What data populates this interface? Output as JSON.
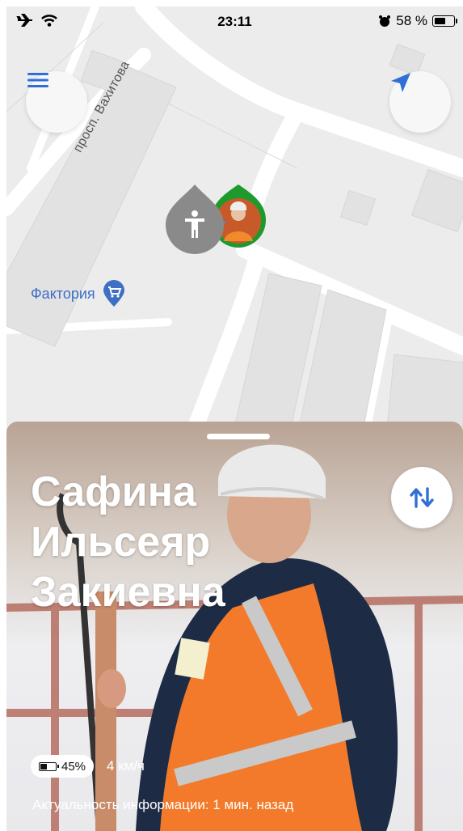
{
  "status_bar": {
    "time": "23:11",
    "battery_percent": "58 %",
    "battery_level": 0.58
  },
  "map": {
    "street_name": "просп. Вахитова",
    "poi_label": "Фактория",
    "icons": {
      "menu": "menu-icon",
      "locate": "location-arrow-icon",
      "poi": "shopping-cart-pin-icon",
      "person": "person-marker-icon"
    },
    "colors": {
      "accent": "#2f6fd6",
      "marker_ring": "#1e9a2c",
      "marker_gray": "#8a8a8a"
    }
  },
  "card": {
    "name_lines": [
      "Сафина",
      "Ильсеяр",
      "Закиевна"
    ],
    "device_battery": "45%",
    "device_battery_level": 0.45,
    "speed": "4 км/ч",
    "updated": "Актуальность информации: 1 мин. назад",
    "swap_icon": "swap-vertical-icon"
  }
}
